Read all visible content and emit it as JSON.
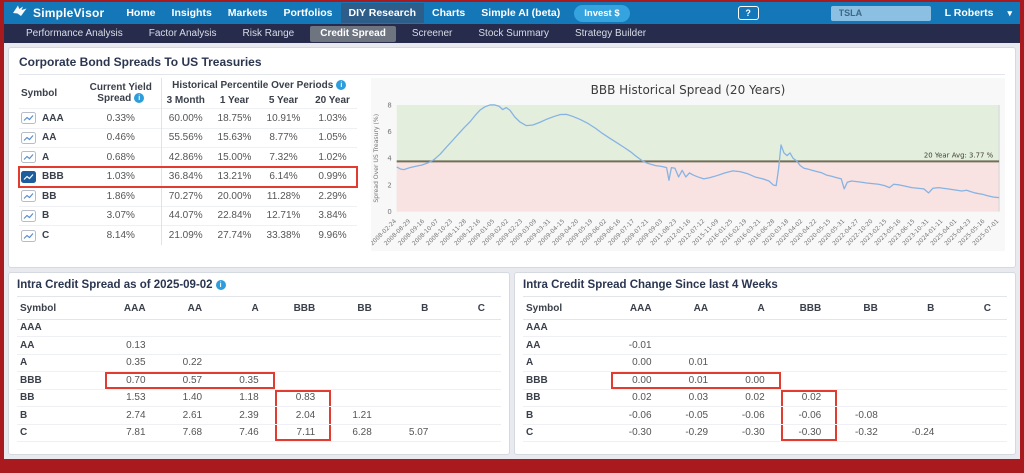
{
  "colors": {
    "top_nav_blue": "#1478b8",
    "sub_nav_navy": "#272c4d",
    "frame_red": "#a81a1e",
    "annotation_red": "#e23b30",
    "invest_button_blue": "#35a3de",
    "selected_icon_blue": "#1d5c9d",
    "info_icon_blue": "#2d9ddb"
  },
  "top_nav": {
    "brand": "SimpleVisor",
    "items": [
      "Home",
      "Insights",
      "Markets",
      "Portfolios",
      "DIY Research",
      "Charts",
      "Simple AI (beta)"
    ],
    "active_item": "DIY Research",
    "invest_button": "Invest $",
    "help_icon": "?",
    "search_value": "TSLA",
    "user_name": "L Roberts",
    "user_chevron": "▾"
  },
  "sub_nav": {
    "items": [
      "Performance Analysis",
      "Factor Analysis",
      "Risk Range",
      "Credit Spread",
      "Screener",
      "Stock Summary",
      "Strategy Builder"
    ],
    "active_item": "Credit Spread"
  },
  "spread_panel": {
    "title": "Corporate Bond Spreads To US Treasuries",
    "table": {
      "col_symbol": "Symbol",
      "col_current_yield": "Current Yield Spread",
      "col_group": "Historical Percentile Over Periods",
      "sub_cols": [
        "3 Month",
        "1 Year",
        "5 Year",
        "20 Year"
      ],
      "rows": [
        {
          "symbol": "AAA",
          "current": "0.33%",
          "p3m": "60.00%",
          "p1y": "18.75%",
          "p5y": "10.91%",
          "p20y": "1.03%",
          "selected": false
        },
        {
          "symbol": "AA",
          "current": "0.46%",
          "p3m": "55.56%",
          "p1y": "15.63%",
          "p5y": "8.77%",
          "p20y": "1.05%",
          "selected": false
        },
        {
          "symbol": "A",
          "current": "0.68%",
          "p3m": "42.86%",
          "p1y": "15.00%",
          "p5y": "7.32%",
          "p20y": "1.02%",
          "selected": false
        },
        {
          "symbol": "BBB",
          "current": "1.03%",
          "p3m": "36.84%",
          "p1y": "13.21%",
          "p5y": "6.14%",
          "p20y": "0.99%",
          "selected": true
        },
        {
          "symbol": "BB",
          "current": "1.86%",
          "p3m": "70.27%",
          "p1y": "20.00%",
          "p5y": "11.28%",
          "p20y": "2.29%",
          "selected": false
        },
        {
          "symbol": "B",
          "current": "3.07%",
          "p3m": "44.07%",
          "p1y": "22.84%",
          "p5y": "12.71%",
          "p20y": "3.84%",
          "selected": false
        },
        {
          "symbol": "C",
          "current": "8.14%",
          "p3m": "21.09%",
          "p1y": "27.74%",
          "p5y": "33.38%",
          "p20y": "9.96%",
          "selected": false
        }
      ]
    }
  },
  "chart_data": {
    "type": "line",
    "title": "BBB Historical Spread (20 Years)",
    "ylabel": "Spread Over US Treasury (%)",
    "ylim": [
      0,
      8
    ],
    "yticks": [
      0,
      2,
      4,
      6,
      8
    ],
    "avg_line": {
      "value": 3.77,
      "label": "20 Year Avg: 3.77 %"
    },
    "legend": "none",
    "grid": false,
    "colors": {
      "line": "#85b3e3",
      "above_avg_fill": "#e4eedd",
      "below_avg_fill": "#f9e2e2",
      "avg_line": "#70705a",
      "axis_text": "#777777",
      "spine": "#cfd4d9"
    },
    "series": [
      {
        "name": "BBB Spread",
        "x": [
          0.0,
          0.006,
          0.012,
          0.022,
          0.032,
          0.042,
          0.052,
          0.062,
          0.072,
          0.082,
          0.092,
          0.102,
          0.112,
          0.122,
          0.13,
          0.138,
          0.146,
          0.155,
          0.163,
          0.17,
          0.176,
          0.182,
          0.188,
          0.196,
          0.205,
          0.215,
          0.226,
          0.238,
          0.25,
          0.262,
          0.272,
          0.282,
          0.292,
          0.305,
          0.318,
          0.33,
          0.342,
          0.354,
          0.366,
          0.378,
          0.388,
          0.396,
          0.402,
          0.408,
          0.415,
          0.422,
          0.43,
          0.438,
          0.444,
          0.448,
          0.452,
          0.456,
          0.462,
          0.468,
          0.474,
          0.48,
          0.486,
          0.492,
          0.5,
          0.51,
          0.52,
          0.532,
          0.545,
          0.558,
          0.57,
          0.582,
          0.595,
          0.608,
          0.618,
          0.625,
          0.63,
          0.634,
          0.638,
          0.643,
          0.648,
          0.653,
          0.658,
          0.664,
          0.67,
          0.676,
          0.682,
          0.69,
          0.698,
          0.706,
          0.713,
          0.722,
          0.73,
          0.738,
          0.743,
          0.748,
          0.755,
          0.764,
          0.772,
          0.78,
          0.79,
          0.8,
          0.81,
          0.818,
          0.825,
          0.835,
          0.845,
          0.855,
          0.865,
          0.875,
          0.883,
          0.89,
          0.9,
          0.907,
          0.915,
          0.923,
          0.93,
          0.938,
          0.946,
          0.953,
          0.96,
          0.966,
          0.973,
          0.98,
          0.99,
          1.0
        ],
        "y": [
          3.35,
          3.2,
          3.15,
          3.3,
          3.4,
          3.5,
          3.65,
          3.9,
          4.3,
          4.8,
          5.3,
          5.8,
          6.3,
          6.75,
          7.2,
          7.6,
          7.85,
          8.0,
          8.0,
          7.9,
          7.65,
          7.8,
          7.6,
          7.1,
          6.7,
          6.45,
          6.5,
          6.7,
          6.95,
          7.15,
          7.28,
          7.3,
          7.15,
          6.9,
          6.6,
          6.25,
          5.85,
          5.5,
          5.15,
          4.8,
          4.5,
          4.2,
          4.0,
          3.8,
          3.65,
          3.55,
          3.45,
          3.4,
          3.35,
          3.3,
          2.35,
          3.3,
          3.25,
          2.6,
          3.1,
          2.6,
          2.9,
          2.75,
          2.6,
          2.45,
          2.55,
          2.7,
          2.9,
          3.05,
          3.0,
          2.85,
          2.6,
          2.45,
          2.3,
          2.0,
          1.95,
          3.2,
          5.0,
          4.4,
          4.2,
          4.4,
          4.0,
          3.8,
          3.45,
          3.25,
          3.2,
          3.1,
          3.0,
          2.9,
          2.75,
          2.65,
          2.55,
          2.45,
          1.7,
          2.2,
          2.3,
          2.25,
          2.2,
          2.15,
          2.1,
          2.05,
          1.95,
          1.8,
          2.05,
          2.0,
          1.9,
          1.8,
          1.75,
          1.7,
          1.4,
          1.75,
          1.8,
          1.75,
          1.7,
          1.65,
          1.6,
          1.55,
          1.6,
          1.5,
          1.4,
          1.35,
          1.3,
          1.2,
          1.1,
          1.05
        ]
      }
    ],
    "x_tick_labels": [
      "2008-02-24",
      "2008-08-29",
      "2008-09-16",
      "2008-10-07",
      "2008-10-23",
      "2008-11-28",
      "2008-12-16",
      "2009-01-05",
      "2009-02-02",
      "2009-02-23",
      "2009-03-09",
      "2009-03-31",
      "2009-04-15",
      "2009-04-20",
      "2009-05-19",
      "2009-06-02",
      "2009-06-16",
      "2009-07-17",
      "2009-07-21",
      "2009-09-03",
      "2011-08-23",
      "2012-01-16",
      "2012-07-12",
      "2015-11-09",
      "2016-01-25",
      "2016-02-19",
      "2016-03-21",
      "2016-06-28",
      "2020-03-18",
      "2020-04-02",
      "2020-04-22",
      "2020-05-15",
      "2020-05-31",
      "2022-04-27",
      "2022-10-20",
      "2023-02-15",
      "2023-05-16",
      "2023-06-15",
      "2023-10-31",
      "2024-01-11",
      "2025-04-01",
      "2025-04-23",
      "2025-05-16",
      "2025-07-01"
    ]
  },
  "intra_spread": {
    "title": "Intra Credit Spread as of 2025-09-02",
    "has_info_icon": true,
    "columns": [
      "Symbol",
      "AAA",
      "AA",
      "A",
      "BBB",
      "BB",
      "B",
      "C"
    ],
    "rows": [
      {
        "symbol": "AAA",
        "values": [
          "",
          "",
          "",
          "",
          "",
          "",
          ""
        ]
      },
      {
        "symbol": "AA",
        "values": [
          "0.13",
          "",
          "",
          "",
          "",
          "",
          ""
        ]
      },
      {
        "symbol": "A",
        "values": [
          "0.35",
          "0.22",
          "",
          "",
          "",
          "",
          ""
        ]
      },
      {
        "symbol": "BBB",
        "values": [
          "0.70",
          "0.57",
          "0.35",
          "",
          "",
          "",
          ""
        ]
      },
      {
        "symbol": "BB",
        "values": [
          "1.53",
          "1.40",
          "1.18",
          "0.83",
          "",
          "",
          ""
        ]
      },
      {
        "symbol": "B",
        "values": [
          "2.74",
          "2.61",
          "2.39",
          "2.04",
          "1.21",
          "",
          ""
        ]
      },
      {
        "symbol": "C",
        "values": [
          "7.81",
          "7.68",
          "7.46",
          "7.11",
          "6.28",
          "5.07",
          ""
        ]
      }
    ],
    "annotations": {
      "row_box": {
        "row_index": 3,
        "col_from": 0,
        "col_to": 2
      },
      "col_box": {
        "col_index": 3,
        "row_from": 4,
        "row_to": 6
      }
    }
  },
  "intra_change": {
    "title": "Intra Credit Spread Change Since last 4 Weeks",
    "has_info_icon": false,
    "columns": [
      "Symbol",
      "AAA",
      "AA",
      "A",
      "BBB",
      "BB",
      "B",
      "C"
    ],
    "rows": [
      {
        "symbol": "AAA",
        "values": [
          "",
          "",
          "",
          "",
          "",
          "",
          ""
        ]
      },
      {
        "symbol": "AA",
        "values": [
          "-0.01",
          "",
          "",
          "",
          "",
          "",
          ""
        ]
      },
      {
        "symbol": "A",
        "values": [
          "0.00",
          "0.01",
          "",
          "",
          "",
          "",
          ""
        ]
      },
      {
        "symbol": "BBB",
        "values": [
          "0.00",
          "0.01",
          "0.00",
          "",
          "",
          "",
          ""
        ]
      },
      {
        "symbol": "BB",
        "values": [
          "0.02",
          "0.03",
          "0.02",
          "0.02",
          "",
          "",
          ""
        ]
      },
      {
        "symbol": "B",
        "values": [
          "-0.06",
          "-0.05",
          "-0.06",
          "-0.06",
          "-0.08",
          "",
          ""
        ]
      },
      {
        "symbol": "C",
        "values": [
          "-0.30",
          "-0.29",
          "-0.30",
          "-0.30",
          "-0.32",
          "-0.24",
          ""
        ]
      }
    ],
    "annotations": {
      "row_box": {
        "row_index": 3,
        "col_from": 0,
        "col_to": 2
      },
      "col_box": {
        "col_index": 3,
        "row_from": 4,
        "row_to": 6
      }
    }
  }
}
